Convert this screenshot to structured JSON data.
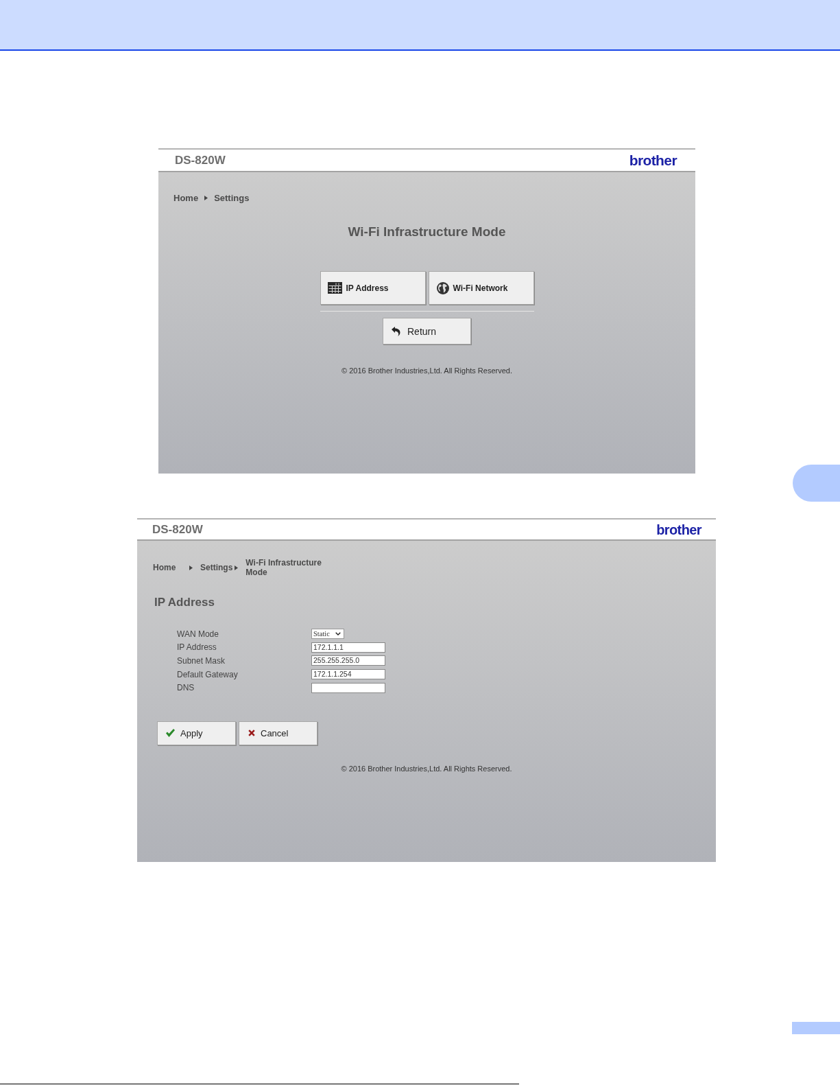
{
  "screens": [
    {
      "kind": "menu",
      "model": "DS-820W",
      "logo": "brother",
      "breadcrumb": [
        "Home",
        "Settings"
      ],
      "title": "Wi-Fi Infrastructure Mode",
      "menu_buttons": [
        {
          "label": "IP Address"
        },
        {
          "label": "Wi-Fi Network"
        }
      ],
      "return_button": "Return",
      "copyright": "© 2016 Brother Industries,Ltd. All Rights Reserved."
    },
    {
      "kind": "form",
      "model": "DS-820W",
      "logo": "brother",
      "breadcrumb": [
        "Home",
        "Settings",
        "Wi-Fi Infrastructure Mode"
      ],
      "title": "IP Address",
      "fields": [
        {
          "label": "WAN Mode",
          "kind": "select",
          "value": "Static"
        },
        {
          "label": "IP Address",
          "kind": "text",
          "value": "172.1.1.1"
        },
        {
          "label": "Subnet Mask",
          "kind": "text",
          "value": "255.255.255.0"
        },
        {
          "label": "Default Gateway",
          "kind": "text",
          "value": "172.1.1.254"
        },
        {
          "label": "DNS",
          "kind": "text"
        }
      ],
      "actions": [
        {
          "label": "Apply"
        },
        {
          "label": "Cancel"
        }
      ],
      "copyright": "© 2016 Brother Industries,Ltd. All Rights Reserved."
    }
  ]
}
